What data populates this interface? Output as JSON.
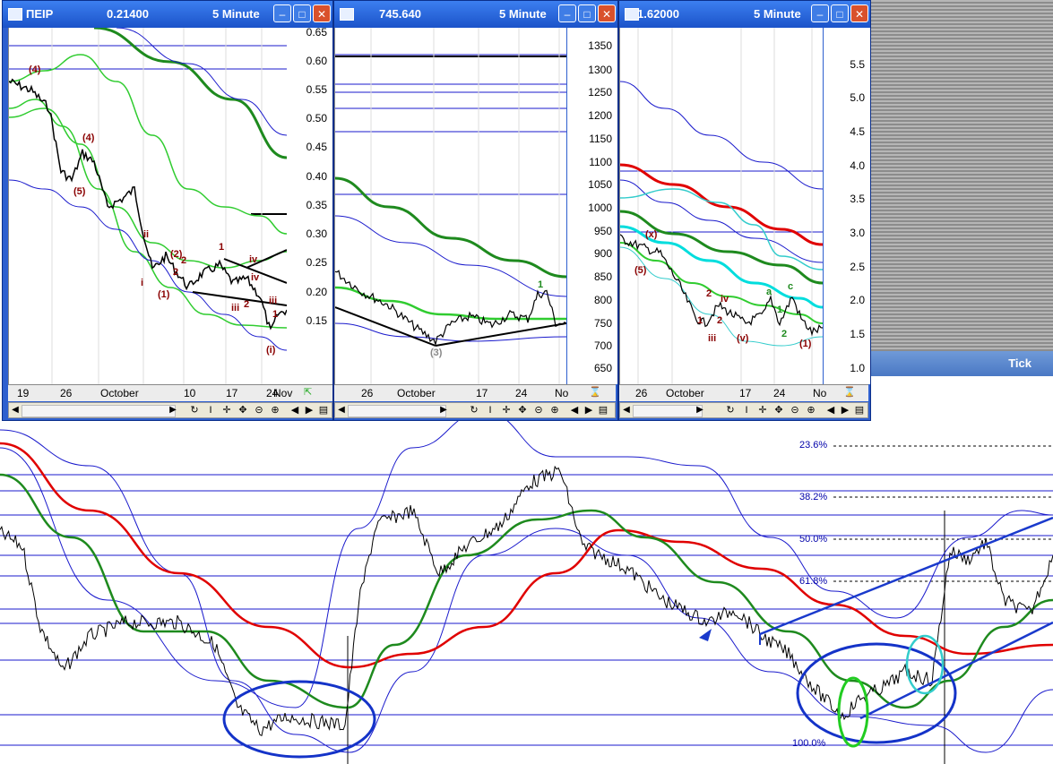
{
  "desktop": {
    "tick_label": "Tick"
  },
  "windows": [
    {
      "symbol": "ΠΕΙΡ",
      "value": "0.21400",
      "timeframe": "5 Minute",
      "y_ticks": [
        "0.65",
        "0.60",
        "0.55",
        "0.50",
        "0.45",
        "0.40",
        "0.35",
        "0.30",
        "0.25",
        "0.20",
        "0.15"
      ],
      "x_ticks": [
        "19",
        "26",
        "October",
        "10",
        "17",
        "24",
        "Nov"
      ],
      "wave_labels": [
        "(4)",
        "(4)",
        "(5)",
        "ii",
        "i",
        "(1)",
        "(2)",
        "2",
        "2",
        "1",
        "iii",
        "2",
        "iv",
        "iv",
        "iii",
        "1",
        "(i)"
      ],
      "corner_icon": "green-arrows-icon"
    },
    {
      "symbol": "",
      "value": "745.640",
      "timeframe": "5 Minute",
      "y_ticks": [
        "1350",
        "1300",
        "1250",
        "1200",
        "1150",
        "1100",
        "1050",
        "1000",
        "950",
        "900",
        "850",
        "800",
        "750",
        "700",
        "650"
      ],
      "x_ticks": [
        "26",
        "October",
        "17",
        "24",
        "No"
      ],
      "wave_labels": [
        "1",
        "(3)"
      ],
      "corner_icon": "red-hourglass-icon"
    },
    {
      "symbol": "",
      "value": "1.62000",
      "timeframe": "5 Minute",
      "y_ticks": [
        "5.5",
        "5.0",
        "4.5",
        "4.0",
        "3.5",
        "3.0",
        "2.5",
        "2.0",
        "1.5",
        "1.0"
      ],
      "x_ticks": [
        "26",
        "October",
        "17",
        "24",
        "No"
      ],
      "wave_labels": [
        "(x)",
        "(5)",
        "iv",
        "2",
        "1",
        "2",
        "iii",
        "(v)",
        "a",
        "c",
        "1",
        "2",
        "(1)"
      ],
      "corner_icon": "green-hourglass-icon"
    }
  ],
  "main_chart": {
    "fib_levels": [
      "23.6%",
      "38.2%",
      "50.0%",
      "61.8%",
      "100.0%"
    ]
  },
  "toolbar_icons": [
    "sync-icon",
    "cursor-icon",
    "crosshair-icon",
    "move-icon",
    "zoom-out-icon",
    "zoom-in-icon",
    "scroll-left-icon",
    "scroll-right-icon",
    "panel-icon"
  ],
  "colors": {
    "window_blue": "#2d5fcf",
    "close_red": "#d9512c",
    "ma_red": "#e00000",
    "ma_green": "#1e8a1e",
    "band_blue": "#0000cc"
  }
}
